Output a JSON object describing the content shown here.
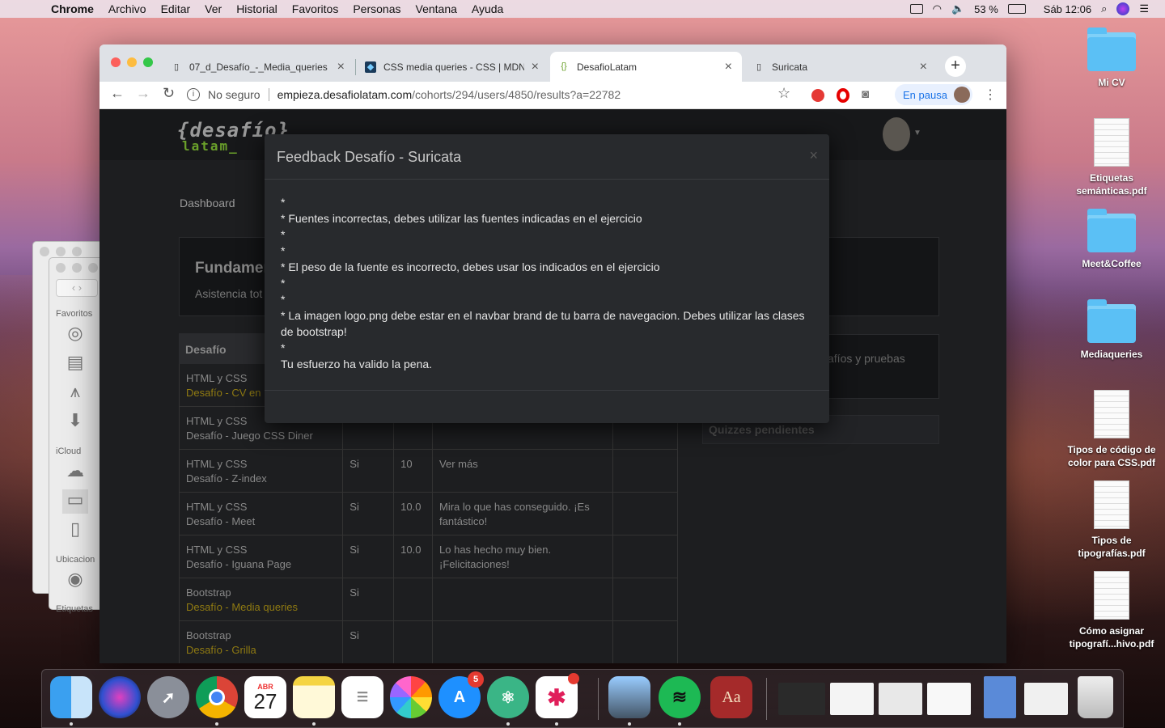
{
  "menubar": {
    "app": "Chrome",
    "items": [
      "Archivo",
      "Editar",
      "Ver",
      "Historial",
      "Favoritos",
      "Personas",
      "Ventana",
      "Ayuda"
    ],
    "battery": "53 %",
    "clock": "Sáb 12:06"
  },
  "desktop": [
    {
      "label": "Mi CV",
      "kind": "folder"
    },
    {
      "label": "Etiquetas semánticas.pdf",
      "kind": "doc"
    },
    {
      "label": "Meet&Coffee",
      "kind": "folder"
    },
    {
      "label": "Mediaqueries",
      "kind": "folder"
    },
    {
      "label": "Tipos de código de color para CSS.pdf",
      "kind": "doc"
    },
    {
      "label": "Tipos de tipografías.pdf",
      "kind": "doc"
    },
    {
      "label": "Cómo asignar tipografí...hivo.pdf",
      "kind": "doc"
    }
  ],
  "finder": {
    "favorites_label": "Favoritos",
    "icloud_label": "iCloud",
    "locations_label": "Ubicacion",
    "tags_label": "Etiquetas"
  },
  "tabs": [
    {
      "title": "07_d_Desafío_-_Media_queries",
      "icon": "doc-icon"
    },
    {
      "title": "CSS media queries - CSS | MDN",
      "icon": "mdn-icon"
    },
    {
      "title": "DesafioLatam",
      "icon": "desafio-icon"
    },
    {
      "title": "Suricata",
      "icon": "doc-icon"
    }
  ],
  "omnibox": {
    "security": "No seguro",
    "host": "empieza.desafiolatam.com",
    "path": "/cohorts/294/users/4850/results?a=22782"
  },
  "profile": {
    "label": "En pausa"
  },
  "site": {
    "logo_top": "{desafío}",
    "logo_bottom": "latam_",
    "nav_dashboard": "Dashboard",
    "card_title": "Fundamen",
    "card_sub": "Asistencia tot",
    "table_header": "Desafío",
    "right_text": "afíos y pruebas",
    "quizzes": "Quizzes pendientes",
    "rows": [
      {
        "course": "HTML y CSS",
        "name": "Desafío - CV en l",
        "done": "",
        "score": "",
        "feedback": "",
        "link": true
      },
      {
        "course": "HTML y CSS",
        "name": "Desafío - Juego CSS Diner",
        "done": "",
        "score": "",
        "feedback": "",
        "link": false
      },
      {
        "course": "HTML y CSS",
        "name": "Desafío - Z-index",
        "done": "Si",
        "score": "10",
        "feedback": "Ver más",
        "link": false
      },
      {
        "course": "HTML y CSS",
        "name": "Desafío - Meet",
        "done": "Si",
        "score": "10.0",
        "feedback": "Mira lo que has conseguido. ¡Es fantástico!",
        "link": false
      },
      {
        "course": "HTML y CSS",
        "name": "Desafío - Iguana Page",
        "done": "Si",
        "score": "10.0",
        "feedback": "Lo has hecho muy bien. ¡Felicitaciones!",
        "link": false
      },
      {
        "course": "Bootstrap",
        "name": "Desafío - Media queries",
        "done": "Si",
        "score": "",
        "feedback": "",
        "link": true
      },
      {
        "course": "Bootstrap",
        "name": "Desafío - Grilla",
        "done": "Si",
        "score": "",
        "feedback": "",
        "link": true
      }
    ]
  },
  "modal": {
    "title": "Feedback Desafío - Suricata",
    "close": "×",
    "lines": [
      "*",
      "* Fuentes incorrectas, debes utilizar las fuentes indicadas en el ejercicio",
      "*",
      "*",
      "* El peso de la fuente es incorrecto, debes usar los indicados en el ejercicio",
      "*",
      "*",
      "* La imagen logo.png debe estar en el navbar brand de tu barra de navegacion. Debes utilizar las clases de bootstrap!",
      "*",
      "Tu esfuerzo ha valido la pena."
    ]
  },
  "dock": {
    "calendar_month": "ABR",
    "calendar_day": "27",
    "appstore_badge": "5",
    "dictionary_label": "Aa"
  }
}
